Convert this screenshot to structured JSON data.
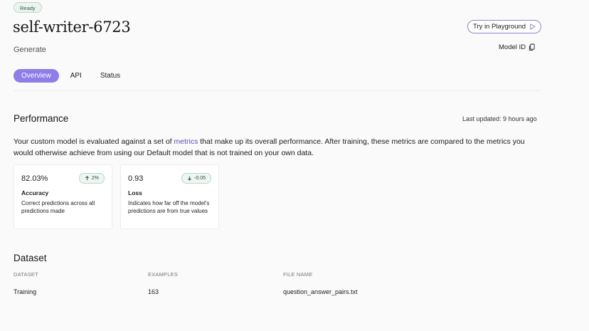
{
  "header": {
    "status_badge": "Ready",
    "model_name": "self-writer-6723",
    "model_type": "Generate",
    "try_button": "Try in Playground",
    "model_id_label": "Model ID"
  },
  "tabs": [
    {
      "label": "Overview",
      "active": true
    },
    {
      "label": "API",
      "active": false
    },
    {
      "label": "Status",
      "active": false
    }
  ],
  "performance": {
    "title": "Performance",
    "last_updated": "Last updated: 9 hours ago",
    "description_before": "Your custom model is evaluated against a set of ",
    "description_link": "metrics",
    "description_after": " that make up its overall performance. After training, these metrics are compared to the metrics you would otherwise achieve from using our Default model that is not trained on your own data.",
    "metrics": [
      {
        "value": "82.03%",
        "delta": "2%",
        "direction": "up",
        "label": "Accuracy",
        "description": "Correct predictions across all predictions made"
      },
      {
        "value": "0.93",
        "delta": "-0.05",
        "direction": "down",
        "label": "Loss",
        "description": "Indicates how far off the model's predictions are from true values"
      }
    ]
  },
  "dataset": {
    "title": "Dataset",
    "columns": [
      "DATASET",
      "EXAMPLES",
      "FILE NAME"
    ],
    "rows": [
      [
        "Training",
        "163",
        "question_answer_pairs.txt"
      ]
    ]
  },
  "colors": {
    "accent": "#8f7de8",
    "link": "#5a4fb8",
    "badge_border": "#b9d9c9",
    "badge_bg": "#eaf4ee"
  },
  "icons": {
    "play": "play-icon",
    "copy": "copy-icon",
    "up_arrow": "arrow-up-icon",
    "down_arrow": "arrow-down-icon"
  }
}
